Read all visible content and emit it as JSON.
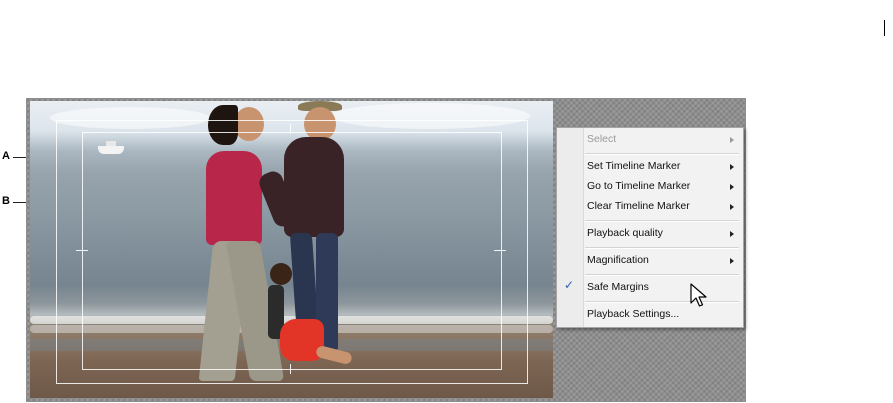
{
  "callouts": {
    "a": "A",
    "b": "B"
  },
  "context_menu": {
    "items": [
      {
        "label": "Select",
        "enabled": false,
        "submenu": true,
        "checked": false
      },
      {
        "label": "Set Timeline Marker",
        "enabled": true,
        "submenu": true,
        "checked": false
      },
      {
        "label": "Go to Timeline Marker",
        "enabled": true,
        "submenu": true,
        "checked": false
      },
      {
        "label": "Clear Timeline Marker",
        "enabled": true,
        "submenu": true,
        "checked": false
      },
      {
        "label": "Playback quality",
        "enabled": true,
        "submenu": true,
        "checked": false
      },
      {
        "label": "Magnification",
        "enabled": true,
        "submenu": true,
        "checked": false
      },
      {
        "label": "Safe Margins",
        "enabled": true,
        "submenu": false,
        "checked": true
      },
      {
        "label": "Playback Settings...",
        "enabled": true,
        "submenu": false,
        "checked": false
      }
    ],
    "check_glyph": "✓"
  },
  "colors": {
    "menu_background": "#f2f2f2",
    "check_mark": "#2a5db0",
    "safe_margin_lines": "#ffffff",
    "panel_background": "#8f8f8f"
  }
}
